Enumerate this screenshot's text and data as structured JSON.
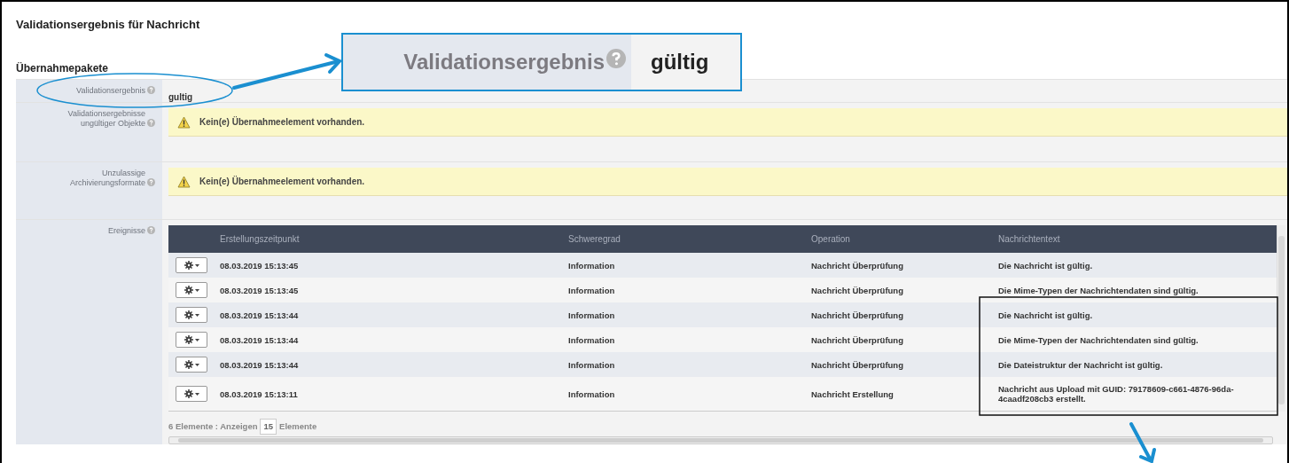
{
  "window": {
    "title": "Validationsergebnis für Nachricht"
  },
  "section": {
    "title": "Übernahmepakete"
  },
  "fields": [
    {
      "kind": "text",
      "label": "Validationsergebnis",
      "value": "gultig"
    },
    {
      "kind": "warning",
      "label": "Validationsergebnisse ungültiger Objekte",
      "message": "Kein(e) Übernahmeelement vorhanden."
    },
    {
      "kind": "warning",
      "label": "Unzulassige Archivierungsformate",
      "message": "Kein(e) Übernahmeelement vorhanden."
    },
    {
      "kind": "table",
      "label": "Ereignisse"
    }
  ],
  "events": {
    "columns": [
      "Erstellungszeitpunkt",
      "Schweregrad",
      "Operation",
      "Nachrichtentext"
    ],
    "rows": [
      [
        "08.03.2019 15:13:45",
        "Information",
        "Nachricht Überprüfung",
        "Die Nachricht ist gültig."
      ],
      [
        "08.03.2019 15:13:45",
        "Information",
        "Nachricht Überprüfung",
        "Die Mime-Typen der Nachrichtendaten sind gültig."
      ],
      [
        "08.03.2019 15:13:44",
        "Information",
        "Nachricht Überprüfung",
        "Die Nachricht ist gültig."
      ],
      [
        "08.03.2019 15:13:44",
        "Information",
        "Nachricht Überprüfung",
        "Die Mime-Typen der Nachrichtendaten sind gültig."
      ],
      [
        "08.03.2019 15:13:44",
        "Information",
        "Nachricht Überprüfung",
        "Die Dateistruktur der Nachricht ist gültig."
      ],
      [
        "08.03.2019 15:13:11",
        "Information",
        "Nachricht Erstellung",
        "Nachricht aus Upload mit GUID: 79178609-c661-4876-96da-4caadf208cb3 erstellt."
      ]
    ],
    "footer": {
      "count_text": "6 Elemente : Anzeigen",
      "page_size": "15",
      "suffix": "Elemente"
    }
  },
  "callout": {
    "label": "Validationsergebnis",
    "value": "gültig"
  }
}
